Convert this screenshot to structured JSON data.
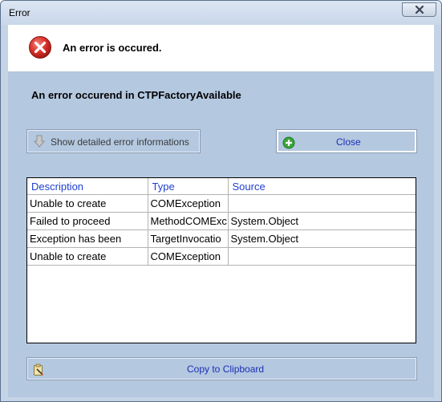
{
  "window": {
    "title": "Error"
  },
  "header": {
    "text": "An error is occured."
  },
  "message": "An error occurend in CTPFactoryAvailable",
  "buttons": {
    "details_label": "Show detailed error informations",
    "close_label": "Close",
    "copy_label": "Copy to Clipboard"
  },
  "grid": {
    "columns": [
      "Description",
      "Type",
      "Source"
    ],
    "rows": [
      [
        "Unable to create",
        "COMException",
        ""
      ],
      [
        "Failed to proceed",
        "MethodCOMExc",
        "System.Object"
      ],
      [
        "Exception has been",
        "TargetInvocatio",
        "System.Object"
      ],
      [
        "Unable to create",
        "COMException",
        ""
      ]
    ]
  },
  "icons": {
    "window_close": "close-icon",
    "header": "error-icon",
    "details": "arrow-down-icon",
    "close": "plus-circle-icon",
    "copy": "clipboard-icon"
  },
  "colors": {
    "accent_text": "#1a2fb5",
    "error_red": "#d9302a",
    "close_green": "#3aa53a",
    "panel_background": "#b4c8e0"
  }
}
